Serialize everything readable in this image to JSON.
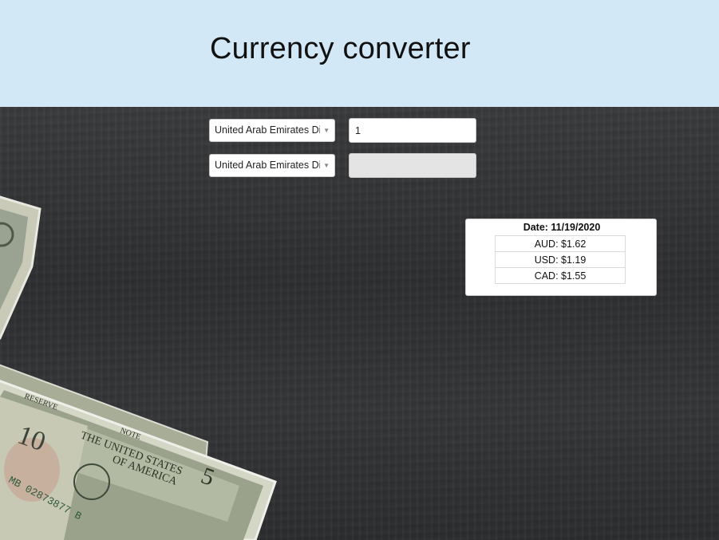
{
  "header": {
    "title": "Currency converter",
    "background_color": "#d3e8f6"
  },
  "converter": {
    "from_currency": "United Arab Emirates Dirham",
    "from_amount": "1",
    "to_currency": "United Arab Emirates Dirham",
    "to_amount": ""
  },
  "rates": {
    "date_label": "Date: 11/19/2020",
    "rows": [
      {
        "text": "AUD: $1.62"
      },
      {
        "text": "USD: $1.19"
      },
      {
        "text": "CAD: $1.55"
      }
    ]
  },
  "background": {
    "description_icon": "money-bills-on-wood-background"
  }
}
